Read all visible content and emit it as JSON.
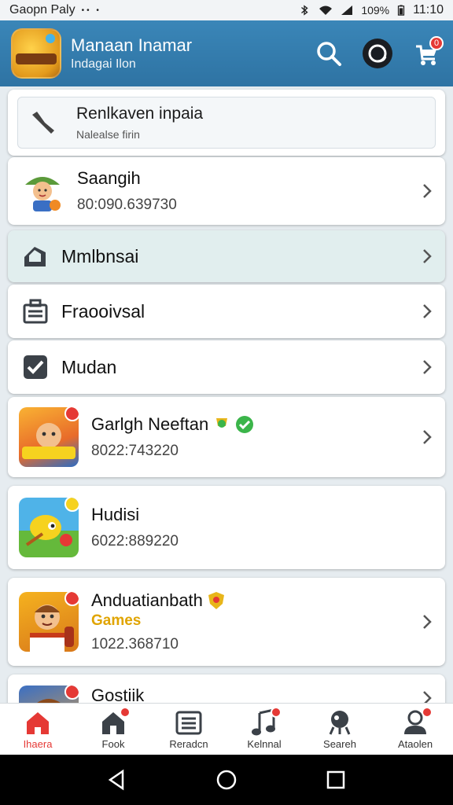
{
  "status_bar": {
    "carrier": "Gaopn Paly",
    "dots": "•• •",
    "battery": "109%",
    "time": "11:10"
  },
  "app_bar": {
    "title": "Manaan Inamar",
    "subtitle": "Indagai Ilon",
    "notification_count": "0"
  },
  "search": {
    "title": "Renlkaven inpaia",
    "hint": "Nalealse firin"
  },
  "profile": {
    "name": "Saangih",
    "number": "80:090.639730"
  },
  "menu": [
    {
      "label": "Mmlbnsai",
      "icon": "tag-icon"
    },
    {
      "label": "Fraooivsal",
      "icon": "briefcase-icon"
    },
    {
      "label": "Mudan",
      "icon": "check-icon"
    }
  ],
  "games": [
    {
      "name": "Garlgh Neeftan",
      "number": "8022:743220",
      "tag": "",
      "colors": [
        "#f9b233",
        "#2b6cc4"
      ]
    },
    {
      "name": "Hudisi",
      "number": "6022:889220",
      "tag": "",
      "colors": [
        "#4fb3e8",
        "#65b93b"
      ]
    },
    {
      "name": "Anduatianbath",
      "number": "1022.368710",
      "tag": "Games",
      "colors": [
        "#f5b21f",
        "#d8781a"
      ]
    },
    {
      "name": "Gostiik",
      "number": "",
      "tag": "",
      "colors": [
        "#3a6fc4",
        "#e8a23a"
      ]
    }
  ],
  "bottom_nav": [
    {
      "label": "Ihaera",
      "icon": "home-icon",
      "active": true
    },
    {
      "label": "Fook",
      "icon": "house-icon",
      "active": false
    },
    {
      "label": "Reradcn",
      "icon": "list-icon",
      "active": false
    },
    {
      "label": "Kelnnal",
      "icon": "music-icon",
      "active": false
    },
    {
      "label": "Seareh",
      "icon": "camera-icon",
      "active": false
    },
    {
      "label": "Ataolen",
      "icon": "user-icon",
      "active": false
    }
  ],
  "colors": {
    "app_bar": "#3a86b8",
    "accent_red": "#e53935",
    "badge_green": "#3bb54a",
    "tag_yellow": "#e0a400"
  }
}
